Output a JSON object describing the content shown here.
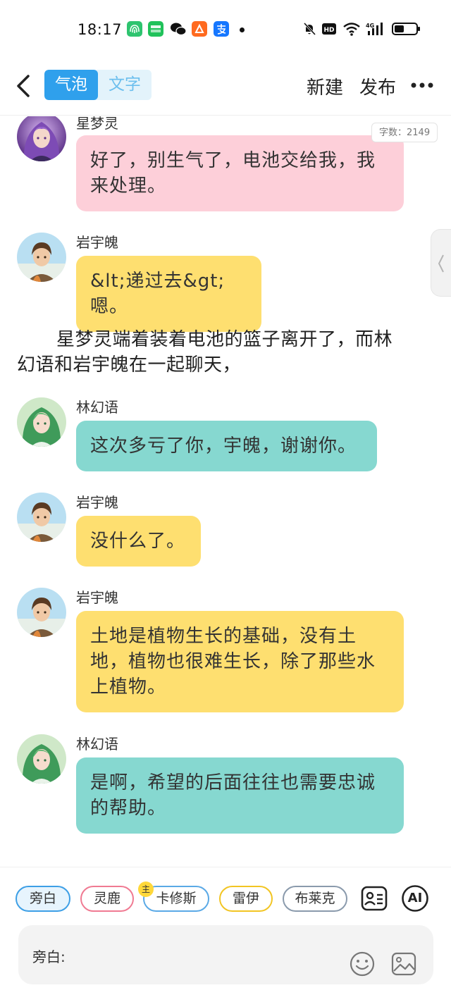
{
  "status_bar": {
    "time": "18:17",
    "apps": [
      "fingerprint-app-icon",
      "iqiyi-app-icon",
      "wechat-app-icon",
      "taobao-app-icon",
      "alipay-app-icon"
    ],
    "right_icons": [
      "mute-bell-icon",
      "hd-icon",
      "wifi-icon",
      "4g-signal-icon",
      "battery-icon"
    ]
  },
  "nav": {
    "mode_tabs": [
      {
        "label": "气泡",
        "active": true
      },
      {
        "label": "文字",
        "active": false
      }
    ],
    "new_label": "新建",
    "publish_label": "发布"
  },
  "word_count": "字数：2149",
  "messages": [
    {
      "type": "bubble",
      "speaker": "星梦灵",
      "avatar": "purple-hair-girl",
      "color": "#fdcfd9",
      "lines": [
        "好了，别生气了，电池交给我，我",
        "来处理。"
      ]
    },
    {
      "type": "bubble",
      "speaker": "岩宇魄",
      "avatar": "brown-hair-boy",
      "color": "#fedf70",
      "lines": [
        "&lt;递过去&gt;嗯。"
      ]
    },
    {
      "type": "narration",
      "lines": [
        "星梦灵端着装着电池的篮子离开了，而林",
        "幻语和岩宇魄在一起聊天，"
      ]
    },
    {
      "type": "bubble",
      "speaker": "林幻语",
      "avatar": "green-hair-girl",
      "color": "#86d8d0",
      "lines": [
        "这次多亏了你，宇魄，谢谢你。"
      ]
    },
    {
      "type": "bubble",
      "speaker": "岩宇魄",
      "avatar": "brown-hair-boy",
      "color": "#fedf70",
      "lines": [
        "没什么了。"
      ]
    },
    {
      "type": "bubble",
      "speaker": "岩宇魄",
      "avatar": "brown-hair-boy",
      "color": "#fedf70",
      "lines": [
        "土地是植物生长的基础，没有土",
        "地，植物也很难生长，除了那些水",
        "上植物。"
      ]
    },
    {
      "type": "bubble",
      "speaker": "林幻语",
      "avatar": "green-hair-girl",
      "color": "#86d8d0",
      "lines": [
        "是啊，希望的后面往往也需要忠诚",
        "的帮助。"
      ]
    }
  ],
  "characters": [
    {
      "label": "旁白",
      "color": "#3d9fe6",
      "selected": true
    },
    {
      "label": "灵鹿",
      "color": "#f07a92",
      "selected": false
    },
    {
      "label": "卡修斯",
      "color": "#5aa9e6",
      "selected": false,
      "badge": "主"
    },
    {
      "label": "雷伊",
      "color": "#f2c523",
      "selected": false
    },
    {
      "label": "布莱克",
      "color": "#8a9aac",
      "selected": false
    }
  ],
  "tools": [
    "character-card-icon",
    "ai-icon"
  ],
  "ai_label": "AI",
  "input": {
    "label": "旁白:"
  }
}
